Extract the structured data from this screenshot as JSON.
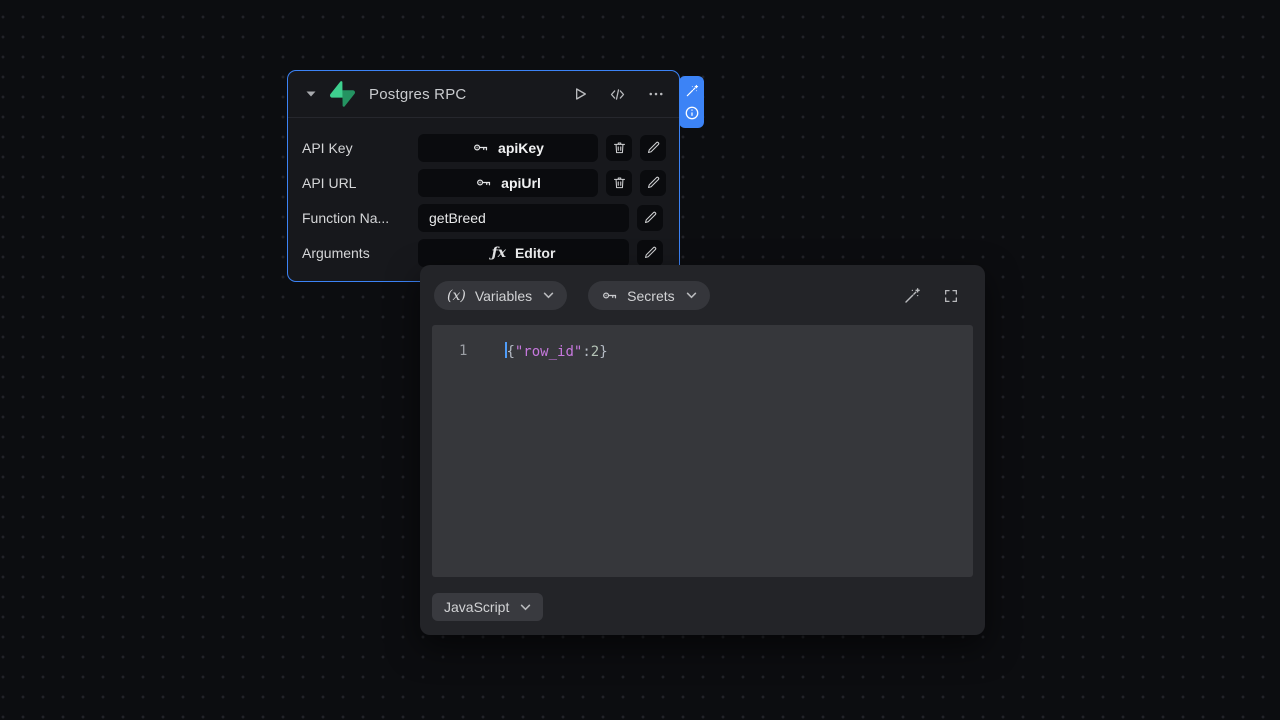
{
  "colors": {
    "accent_blue": "#3c83f6",
    "supabase_green": "#3ecf8e",
    "code_string_purple": "#c678dd",
    "page_background": "#0c0d10"
  },
  "node": {
    "title": "Postgres RPC",
    "rows": [
      {
        "label": "API Key",
        "value": "apiKey",
        "type": "secret"
      },
      {
        "label": "API URL",
        "value": "apiUrl",
        "type": "secret"
      },
      {
        "label": "Function Na...",
        "value": "getBreed",
        "type": "text"
      },
      {
        "label": "Arguments",
        "value": "Editor",
        "type": "editor"
      }
    ]
  },
  "icons": {
    "variables_icon": "(x)",
    "fx_icon": "ƒx"
  },
  "editor_popup": {
    "variables_label": "Variables",
    "secrets_label": "Secrets",
    "line_number": "1",
    "code_plain": "{\"row_id\":2}",
    "code_tokens": [
      {
        "text": "{",
        "type": "punctuation"
      },
      {
        "text": "\"row_id\"",
        "type": "string"
      },
      {
        "text": ":",
        "type": "punctuation"
      },
      {
        "text": "2",
        "type": "number"
      },
      {
        "text": "}",
        "type": "punctuation"
      }
    ],
    "language_label": "JavaScript"
  }
}
